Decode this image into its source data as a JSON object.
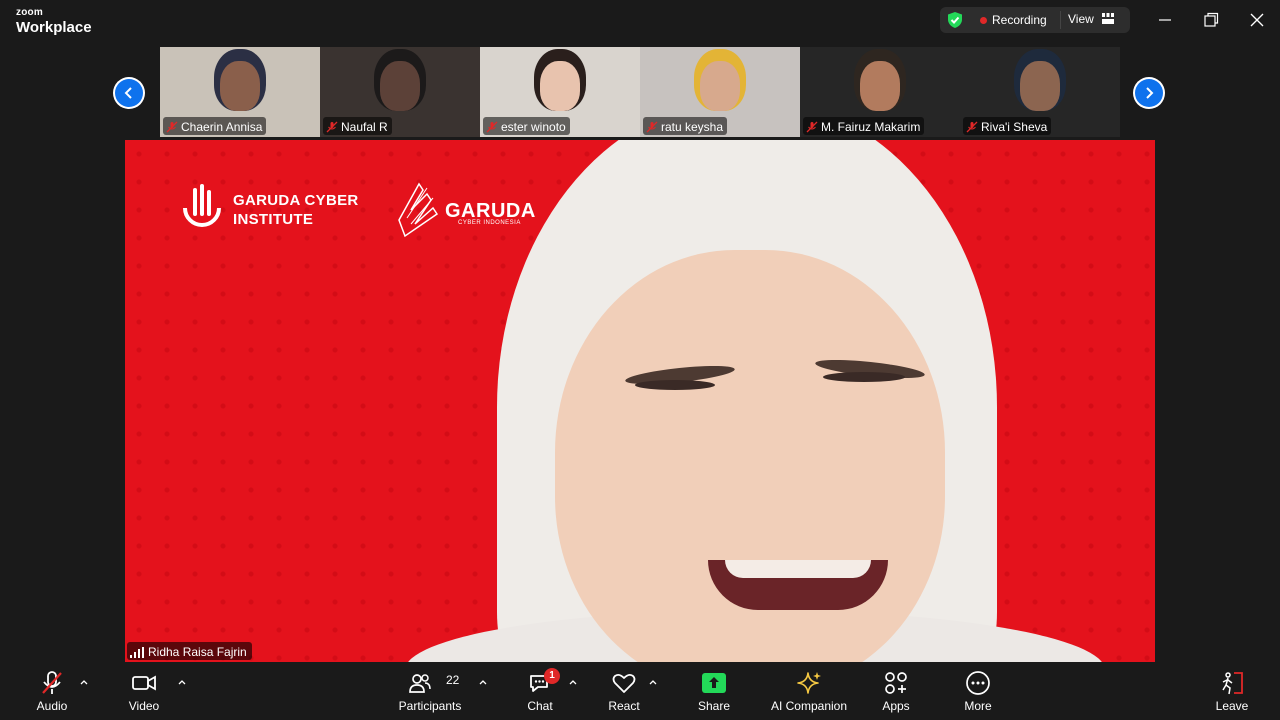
{
  "app": {
    "brand_small": "zoom",
    "brand_large": "Workplace"
  },
  "header": {
    "recording_label": "Recording",
    "view_label": "View"
  },
  "participants": [
    {
      "name": "Chaerin Annisa",
      "bg": "#c9c2b8",
      "face": "#8a5f4b",
      "hood": "#2b2f44"
    },
    {
      "name": "Naufal R",
      "bg": "#3a3330",
      "face": "#5c4138",
      "hood": "#1c1a1a"
    },
    {
      "name": "ester winoto",
      "bg": "#d9d4ce",
      "face": "#e8c3ae",
      "hood": "#2a1f1c"
    },
    {
      "name": "ratu keysha",
      "bg": "#c7c2bf",
      "face": "#d7a98d",
      "hood": "#e3b436"
    },
    {
      "name": "M. Fairuz Makarim",
      "bg": "#262626",
      "face": "#b27b5e",
      "hood": "#2e2620"
    },
    {
      "name": "Riva'i Sheva",
      "bg": "#262626",
      "face": "#8c6550",
      "hood": "#1e2a3c"
    }
  ],
  "main_video": {
    "logo1_line1": "GARUDA CYBER",
    "logo1_line2": "INSTITUTE",
    "logo2_text": "GARUDA",
    "logo2_sub": "CYBER INDONESIA",
    "speaker_name": "Ridha Raisa Fajrin",
    "background_color": "#e4121c"
  },
  "toolbar": {
    "audio": "Audio",
    "video": "Video",
    "participants": "Participants",
    "participants_count": "22",
    "chat": "Chat",
    "chat_badge": "1",
    "react": "React",
    "share": "Share",
    "ai_companion": "AI Companion",
    "apps": "Apps",
    "more": "More",
    "leave": "Leave"
  },
  "colors": {
    "accent_blue": "#0e72ed",
    "share_green": "#23d959",
    "recording_red": "#e02828",
    "muted_red": "#e02828",
    "ai_gold": "#f5c842"
  }
}
